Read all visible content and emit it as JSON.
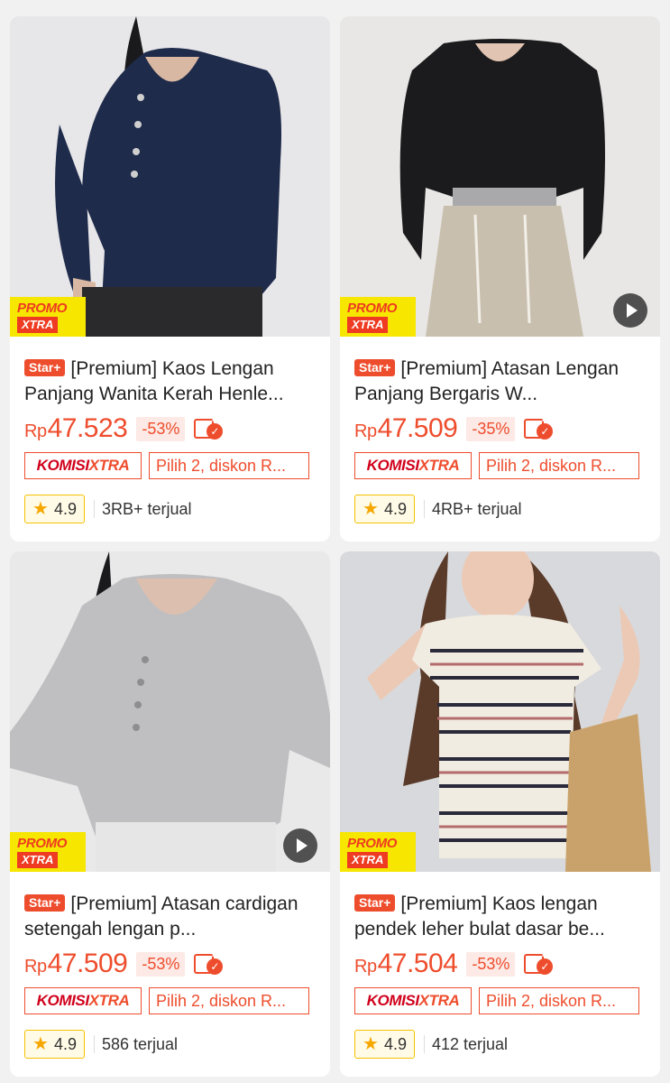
{
  "products": [
    {
      "star_badge": "Star+",
      "title": "[Premium] Kaos Lengan Panjang Wanita Kerah Henle...",
      "currency": "Rp",
      "price": "47.523",
      "discount": "-53%",
      "komisi_a": "KOMISI",
      "komisi_b": "XTRA",
      "promo_line1": "PROMO",
      "promo_line2": "XTRA",
      "pilih": "Pilih 2, diskon R...",
      "rating": "4.9",
      "sold": "3RB+ terjual",
      "has_video": false,
      "image_colors": {
        "bg": "#e7e6e9",
        "garment": "#1f2b4a",
        "skin": "#d9b8a3",
        "pants": "#2a2a2c"
      }
    },
    {
      "star_badge": "Star+",
      "title": "[Premium] Atasan Lengan Panjang Bergaris W...",
      "currency": "Rp",
      "price": "47.509",
      "discount": "-35%",
      "komisi_a": "KOMISI",
      "komisi_b": "XTRA",
      "promo_line1": "PROMO",
      "promo_line2": "XTRA",
      "pilih": "Pilih 2, diskon R...",
      "rating": "4.9",
      "sold": "4RB+ terjual",
      "has_video": true,
      "image_colors": {
        "bg": "#e8e7e5",
        "garment": "#1b1b1d",
        "skin": "#e2c4b2",
        "pants": "#c9bfae"
      }
    },
    {
      "star_badge": "Star+",
      "title": "[Premium] Atasan cardigan setengah lengan p...",
      "currency": "Rp",
      "price": "47.509",
      "discount": "-53%",
      "komisi_a": "KOMISI",
      "komisi_b": "XTRA",
      "promo_line1": "PROMO",
      "promo_line2": "XTRA",
      "pilih": "Pilih 2, diskon R...",
      "rating": "4.9",
      "sold": "586 terjual",
      "has_video": true,
      "image_colors": {
        "bg": "#e9e9ea",
        "garment": "#bfbfc1",
        "skin": "#dcbfaf",
        "pants": "#e6e6e6"
      }
    },
    {
      "star_badge": "Star+",
      "title": "[Premium] Kaos lengan pendek leher bulat dasar be...",
      "currency": "Rp",
      "price": "47.504",
      "discount": "-53%",
      "komisi_a": "KOMISI",
      "komisi_b": "XTRA",
      "promo_line1": "PROMO",
      "promo_line2": "XTRA",
      "pilih": "Pilih 2, diskon R...",
      "rating": "4.9",
      "sold": "412 terjual",
      "has_video": false,
      "image_colors": {
        "bg": "#d8d9dc",
        "garment": "#f1ece2",
        "skin": "#ecc9b5",
        "pants": "#c9a26b"
      }
    }
  ],
  "icons": {
    "star": "star-icon",
    "coupon": "coupon-check-icon",
    "play": "play-icon"
  },
  "accent_color": "#ee4d2d"
}
